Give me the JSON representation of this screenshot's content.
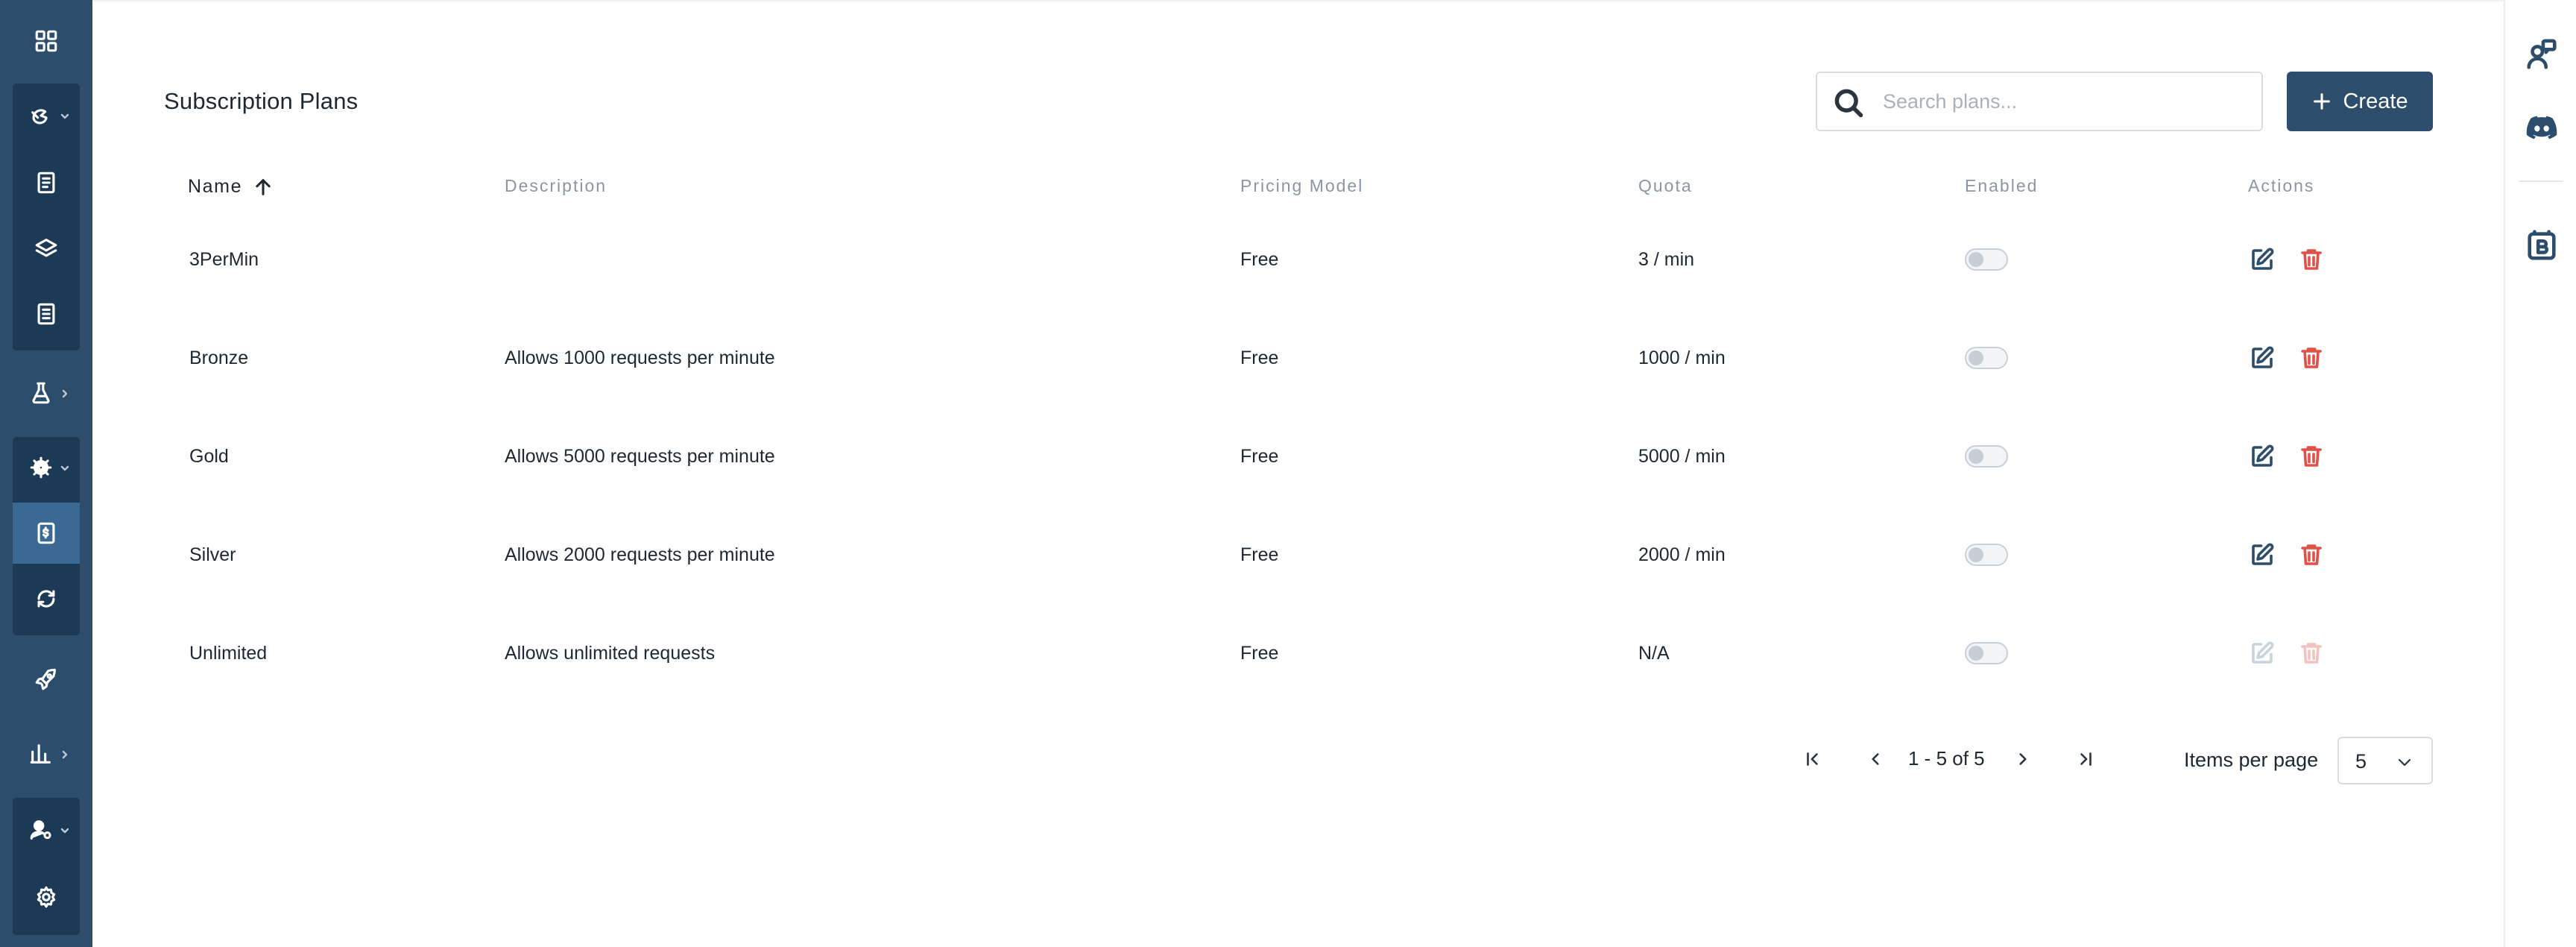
{
  "nav": {
    "items": [
      {
        "name": "dashboard-icon"
      },
      {
        "name": "api-icon"
      },
      {
        "name": "document-icon"
      },
      {
        "name": "layers-icon"
      },
      {
        "name": "list-icon"
      },
      {
        "name": "flask-icon"
      },
      {
        "name": "settings-gear-icon"
      },
      {
        "name": "subscription-plans-icon"
      },
      {
        "name": "sync-icon"
      },
      {
        "name": "rocket-icon"
      },
      {
        "name": "analytics-icon"
      },
      {
        "name": "users-icon"
      },
      {
        "name": "settings-icon"
      }
    ],
    "active": "subscription-plans-icon",
    "colors": {
      "background": "#2c4d6c",
      "group": "#1c3955",
      "active": "#3a6a93"
    }
  },
  "rightrail": {
    "items": [
      {
        "name": "support-chat-icon"
      },
      {
        "name": "discord-icon"
      },
      {
        "name": "b-badge-icon"
      }
    ]
  },
  "page": {
    "title": "Subscription Plans"
  },
  "search": {
    "placeholder": "Search plans..."
  },
  "create_button": {
    "label": "Create",
    "color": "#2c4d6c"
  },
  "table": {
    "headers": {
      "name": "Name",
      "description": "Description",
      "pricing_model": "Pricing Model",
      "quota": "Quota",
      "enabled": "Enabled",
      "actions": "Actions"
    },
    "sort": {
      "column": "name",
      "direction": "ascending"
    },
    "rows": [
      {
        "name": "3PerMin",
        "description": "",
        "pricing_model": "Free",
        "quota": "3 / min",
        "enabled": false,
        "actions_enabled": true
      },
      {
        "name": "Bronze",
        "description": "Allows 1000 requests per minute",
        "pricing_model": "Free",
        "quota": "1000 / min",
        "enabled": false,
        "actions_enabled": true
      },
      {
        "name": "Gold",
        "description": "Allows 5000 requests per minute",
        "pricing_model": "Free",
        "quota": "5000 / min",
        "enabled": false,
        "actions_enabled": true
      },
      {
        "name": "Silver",
        "description": "Allows 2000 requests per minute",
        "pricing_model": "Free",
        "quota": "2000 / min",
        "enabled": false,
        "actions_enabled": true
      },
      {
        "name": "Unlimited",
        "description": "Allows unlimited requests",
        "pricing_model": "Free",
        "quota": "N/A",
        "enabled": false,
        "actions_enabled": false
      }
    ]
  },
  "pagination": {
    "range": "1 - 5 of 5",
    "items_per_page_label": "Items per page",
    "items_per_page": "5"
  },
  "colors": {
    "edit": "#2c4d6c",
    "delete": "#e2504a"
  }
}
